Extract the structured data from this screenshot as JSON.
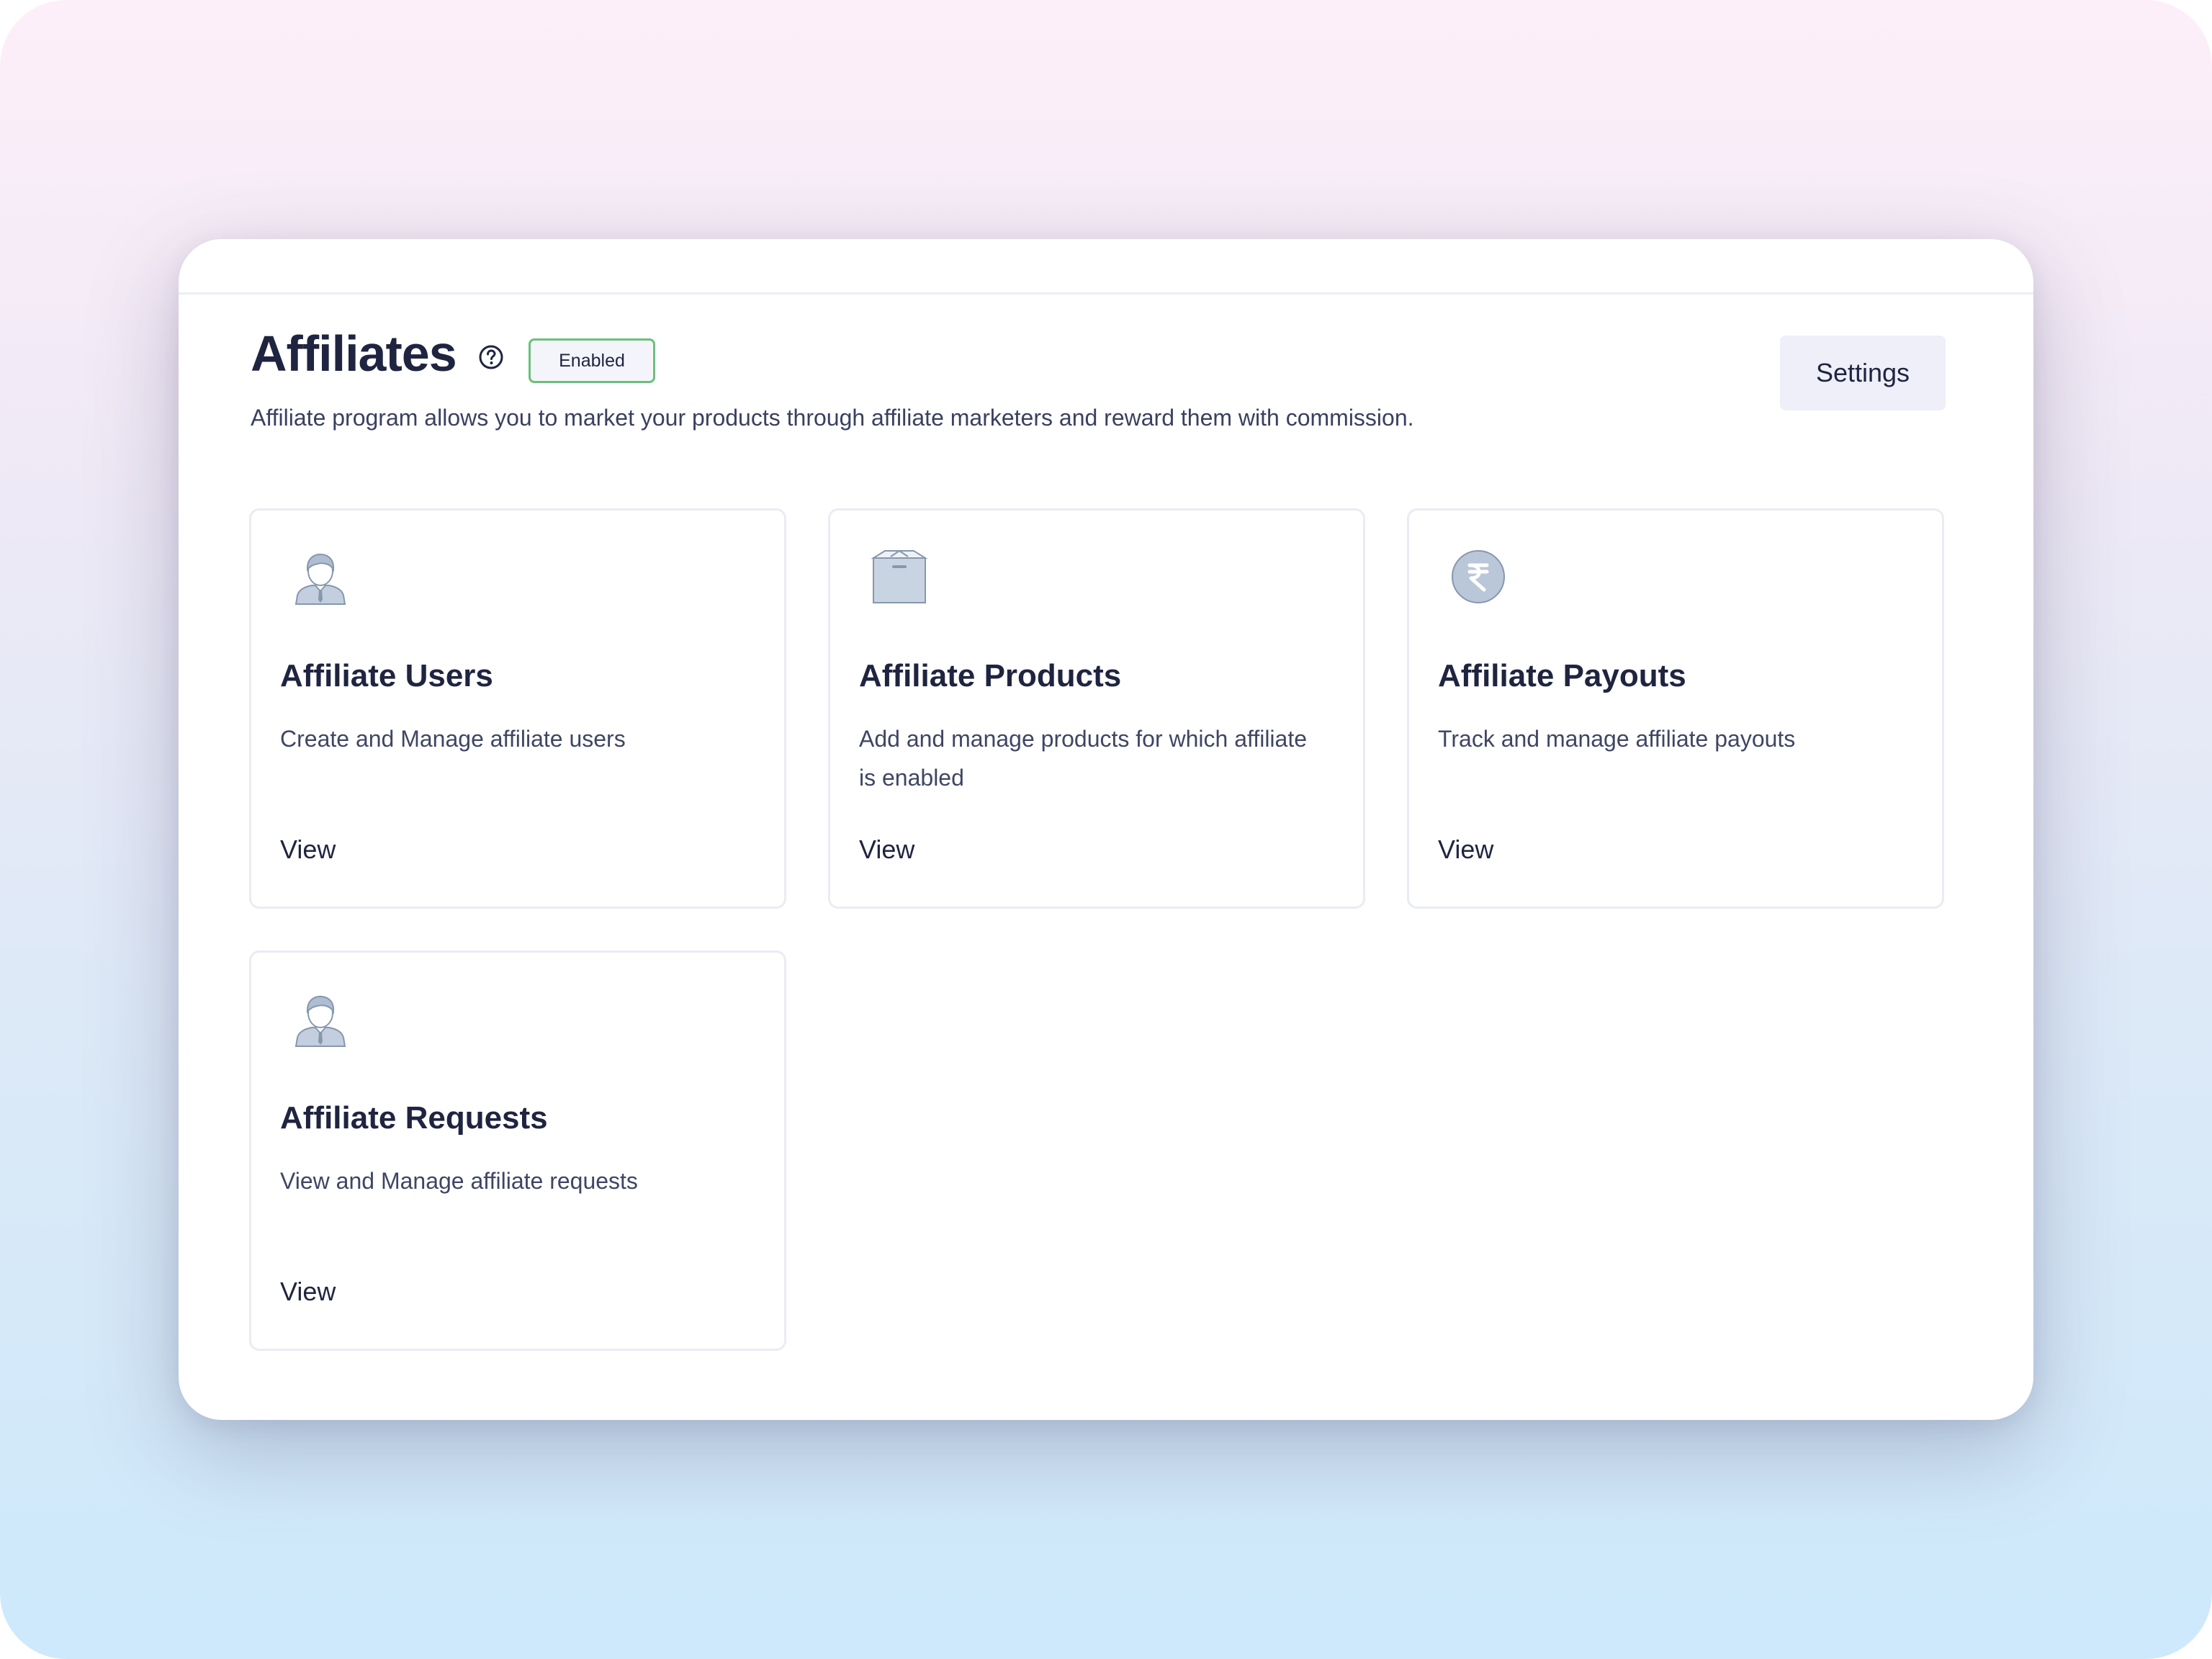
{
  "header": {
    "title": "Affiliates",
    "status": "Enabled",
    "settings_label": "Settings",
    "description": "Affiliate program allows you to market your products through affiliate marketers and reward them with commission."
  },
  "cards": [
    {
      "icon": "user-icon",
      "title": "Affiliate Users",
      "description": "Create and Manage affiliate users",
      "link": "View"
    },
    {
      "icon": "box-icon",
      "title": "Affiliate Products",
      "description": "Add and manage products for which affiliate is enabled",
      "link": "View"
    },
    {
      "icon": "rupee-coin-icon",
      "title": "Affiliate Payouts",
      "description": "Track and manage affiliate payouts",
      "link": "View"
    },
    {
      "icon": "user-icon",
      "title": "Affiliate Requests",
      "description": "View and Manage affiliate requests",
      "link": "View"
    }
  ],
  "colors": {
    "title_text": "#1f2440",
    "body_text": "#3f4663",
    "badge_border": "#6cc07a",
    "settings_bg": "#eeeff8",
    "card_border": "#eaecf3",
    "icon_fill": "#b9c7d9",
    "icon_stroke": "#8797ad"
  }
}
